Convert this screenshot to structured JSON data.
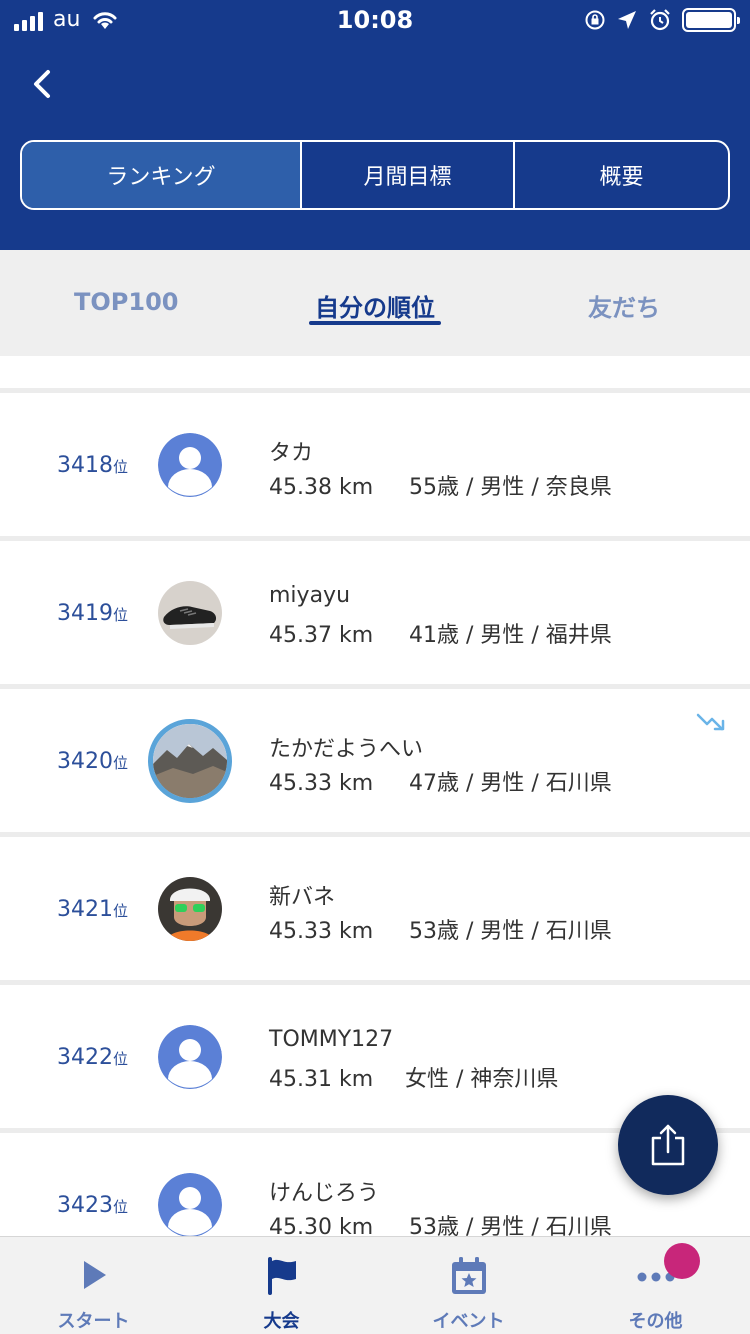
{
  "status_bar": {
    "carrier": "au",
    "time": "10:08"
  },
  "header": {
    "segments": [
      {
        "label": "ランキング",
        "active": true
      },
      {
        "label": "月間目標",
        "active": false
      },
      {
        "label": "概要",
        "active": false
      }
    ]
  },
  "subtabs": [
    {
      "label": "TOP100",
      "active": false
    },
    {
      "label": "自分の順位",
      "active": true
    },
    {
      "label": "友だち",
      "active": false
    }
  ],
  "rank_unit": "位",
  "rows": [
    {
      "rank": "3418",
      "name": "タカ",
      "distance": "45.38 km",
      "profile": "55歳 / 男性 / 奈良県",
      "avatar": "default-person-icon"
    },
    {
      "rank": "3419",
      "name": "miyayu",
      "distance": "45.37 km",
      "profile": "41歳 / 男性 / 福井県",
      "avatar": "shoes-photo"
    },
    {
      "rank": "3420",
      "name": "たかだようへい",
      "distance": "45.33 km",
      "profile": "47歳 / 男性 / 石川県",
      "avatar": "mountain-photo",
      "highlighted": true,
      "trend": "trend-down-icon"
    },
    {
      "rank": "3421",
      "name": "新バネ",
      "distance": "45.33 km",
      "profile": "53歳 / 男性 / 石川県",
      "avatar": "runner-photo"
    },
    {
      "rank": "3422",
      "name": "TOMMY127",
      "distance": "45.31 km",
      "profile": "女性 / 神奈川県",
      "avatar": "default-person-icon"
    },
    {
      "rank": "3423",
      "name": "けんじろう",
      "distance": "45.30 km",
      "profile": "53歳 / 男性 / 石川県",
      "avatar": "default-person-icon"
    }
  ],
  "bottom_nav": [
    {
      "label": "スタート",
      "icon": "play-icon",
      "active": false
    },
    {
      "label": "大会",
      "icon": "flag-icon",
      "active": true
    },
    {
      "label": "イベント",
      "icon": "calendar-star-icon",
      "active": false
    },
    {
      "label": "その他",
      "icon": "more-dots-icon",
      "active": false,
      "badge": true
    }
  ],
  "colors": {
    "brand": "#163a8c",
    "accent_active_segment": "#2e5faa",
    "rank_text": "#2c4f9a",
    "avatar_default": "#5b80d6",
    "highlight_ring": "#5aa4d9",
    "badge": "#c8267a"
  }
}
